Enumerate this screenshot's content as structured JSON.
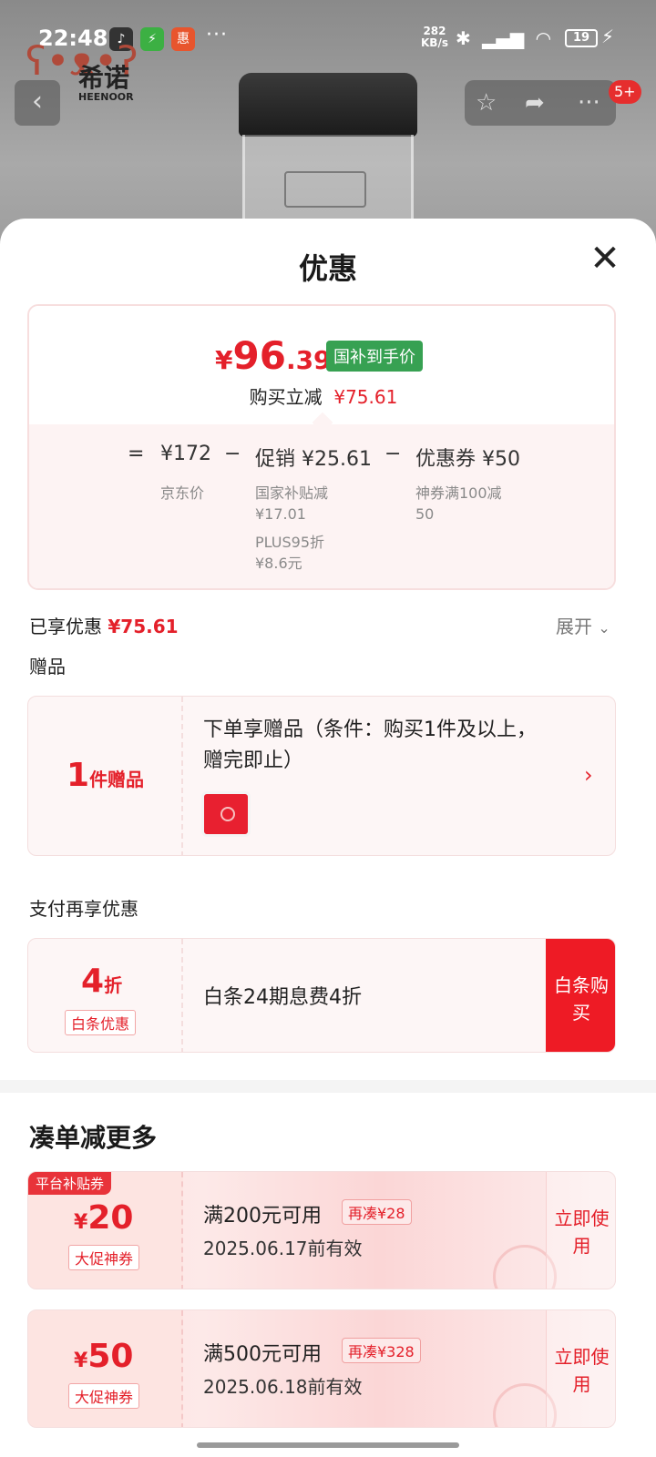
{
  "status_bar": {
    "time": "22:48",
    "speed_value": "282",
    "speed_unit": "KB/s",
    "battery": "19",
    "more": "···"
  },
  "brand": {
    "name_cn": "希诺",
    "name_en": "HEENOOR"
  },
  "top_bar": {
    "badge": "5+"
  },
  "sheet": {
    "title": "优惠",
    "price": {
      "symbol": "¥",
      "integer": "96",
      "decimal": ".39",
      "tag": "国补到手价",
      "save_label": "购买立减",
      "save_value": "¥75.61"
    },
    "formula": {
      "eq": "=",
      "jd_price": "¥172",
      "jd_label": "京东价",
      "minus1": "−",
      "promo": "促销 ¥25.61",
      "promo_sub1": "国家补贴减",
      "promo_sub1_val": "¥17.01",
      "promo_sub2": "PLUS95折",
      "promo_sub2_val": "¥8.6元",
      "minus2": "−",
      "coupon": "优惠券 ¥50",
      "coupon_sub1": "神券满100减",
      "coupon_sub2": "50"
    },
    "enjoyed_label": "已享优惠",
    "enjoyed_value": "¥75.61",
    "expand": "展开",
    "gift_section": "赠品",
    "gift": {
      "count": "1",
      "unit": "件赠品",
      "text": "下单享赠品（条件：购买1件及以上，赠完即止）"
    },
    "pay_section": "支付再享优惠",
    "pay": {
      "discount": "4",
      "unit": "折",
      "tag": "白条优惠",
      "text": "白条24期息费4折",
      "button": "白条购买"
    },
    "more_title": "凑单减更多",
    "coupons": [
      {
        "platform_tag": "平台补贴券",
        "symbol": "¥",
        "amount": "20",
        "tag": "大促神券",
        "condition": "满200元可用",
        "more": "再凑¥28",
        "date": "2025.06.17前有效",
        "button": "立即使用"
      },
      {
        "platform_tag": "",
        "symbol": "¥",
        "amount": "50",
        "tag": "大促神券",
        "condition": "满500元可用",
        "more": "再凑¥328",
        "date": "2025.06.18前有效",
        "button": "立即使用"
      }
    ]
  },
  "colors": {
    "accent_red": "#e4202a",
    "green_tag": "#37a152",
    "pay_button": "#ee1b25"
  }
}
